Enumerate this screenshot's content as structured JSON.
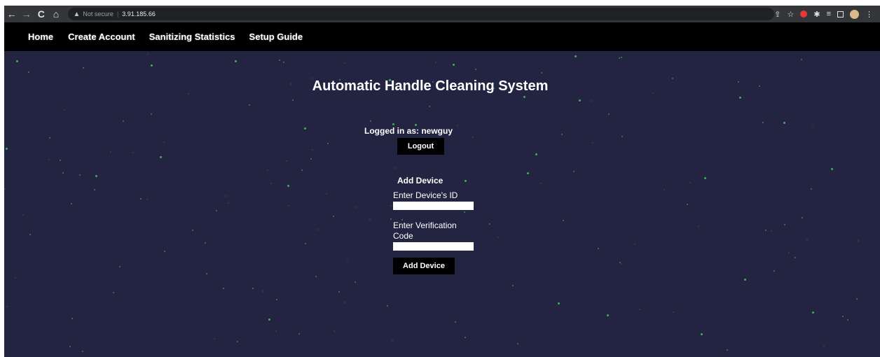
{
  "browser": {
    "back": "←",
    "forward": "→",
    "reload": "C",
    "home": "⌂",
    "security_icon": "warning-icon",
    "security_text": "Not secure",
    "url": "3.91.185.66"
  },
  "nav": {
    "home": "Home",
    "create_account": "Create Account",
    "stats": "Sanitizing Statistics",
    "guide": "Setup Guide"
  },
  "page": {
    "title": "Automatic Handle Cleaning System",
    "logged_in": "Logged in as: newguy",
    "logout_label": "Logout",
    "add_device_heading": "Add Device",
    "device_id_label": "Enter Device's ID",
    "device_id_value": "",
    "verification_label": "Enter Verification Code",
    "verification_value": "",
    "add_device_label": "Add Device"
  },
  "colors": {
    "background": "#232441",
    "navbar": "#000000",
    "stars": "#2f8f47"
  }
}
